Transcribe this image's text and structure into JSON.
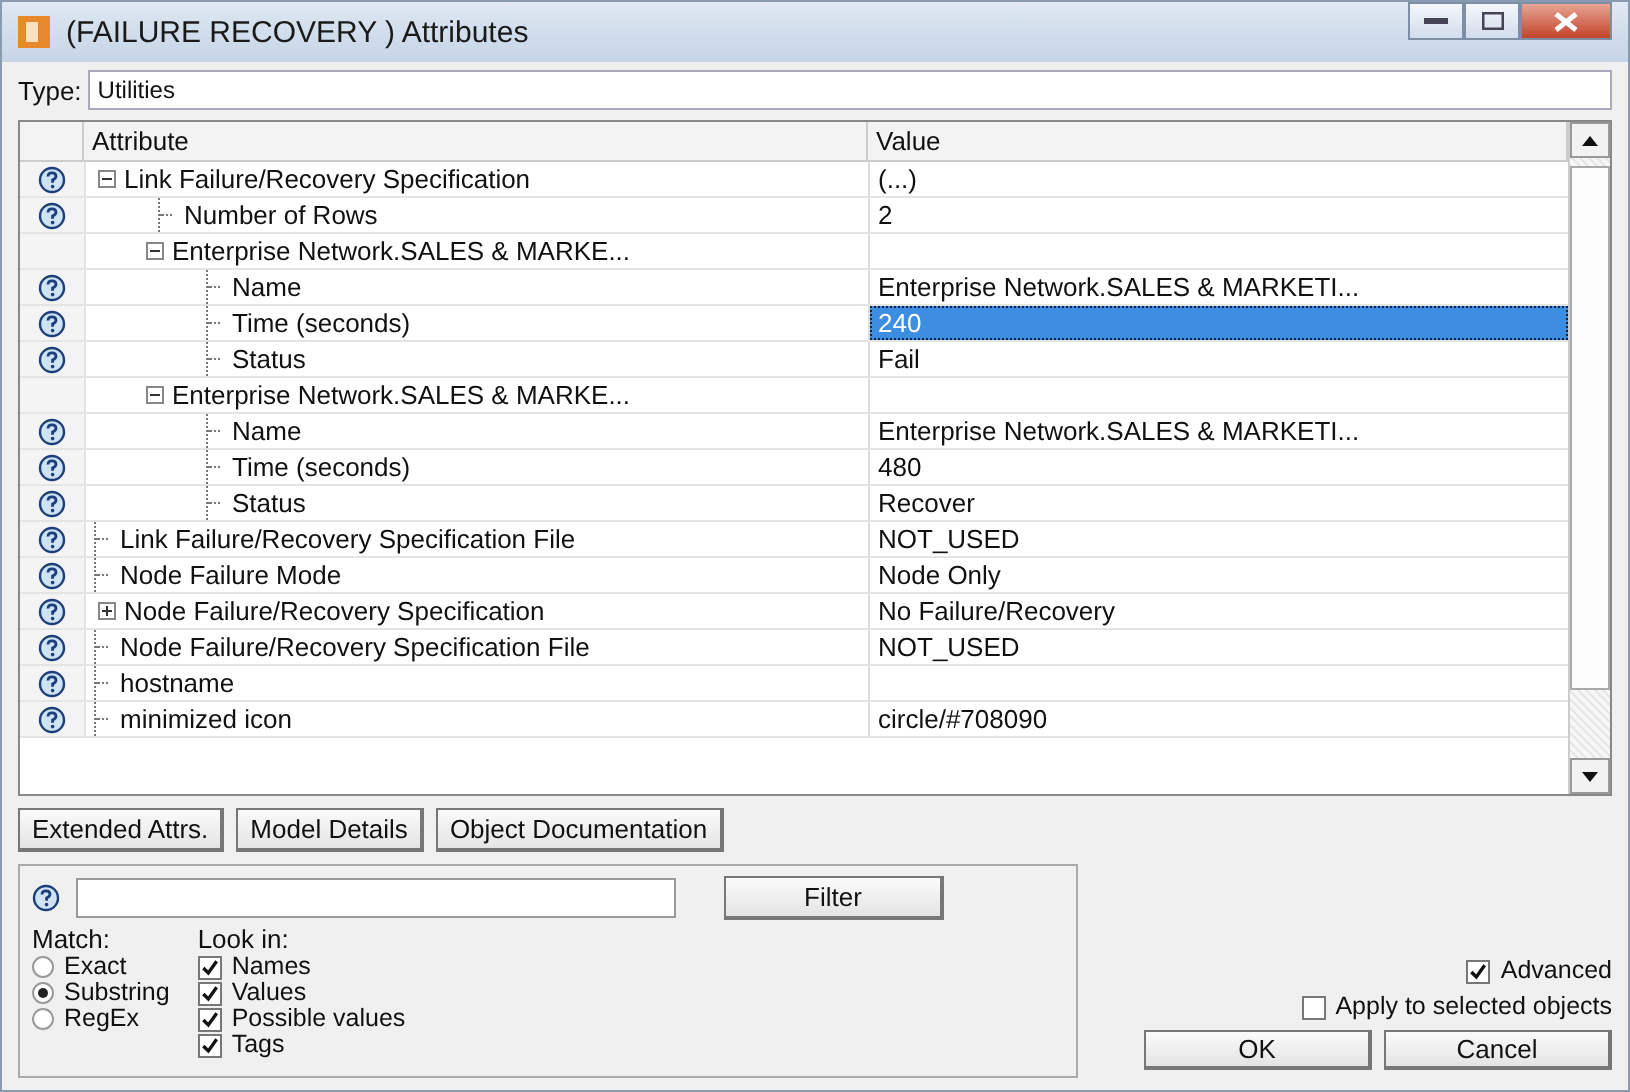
{
  "window": {
    "title": "(FAILURE RECOVERY ) Attributes"
  },
  "type_field": {
    "label": "Type:",
    "value": "Utilities"
  },
  "table": {
    "columns": [
      "Attribute",
      "Value"
    ],
    "rows": [
      {
        "kind": "group",
        "attribute": "Link Failure/Recovery Specification",
        "value": "(...)",
        "help": true,
        "expanded": true,
        "selected": false,
        "children": [
          {
            "kind": "leaf",
            "attribute": "Number of Rows",
            "value": "2",
            "help": true,
            "selected": false
          },
          {
            "kind": "group",
            "attribute": "Enterprise Network.SALES & MARKE...",
            "help": false,
            "expanded": true,
            "selected": false,
            "children": [
              {
                "kind": "leaf",
                "attribute": "Name",
                "value": "Enterprise Network.SALES & MARKETI...",
                "help": true,
                "selected": false
              },
              {
                "kind": "leaf",
                "attribute": "Time (seconds)",
                "value": "240",
                "help": true,
                "selected": true
              },
              {
                "kind": "leaf",
                "attribute": "Status",
                "value": "Fail",
                "help": true,
                "selected": false
              }
            ]
          },
          {
            "kind": "group",
            "attribute": "Enterprise Network.SALES & MARKE...",
            "help": false,
            "expanded": true,
            "selected": false,
            "children": [
              {
                "kind": "leaf",
                "attribute": "Name",
                "value": "Enterprise Network.SALES & MARKETI...",
                "help": true,
                "selected": false
              },
              {
                "kind": "leaf",
                "attribute": "Time (seconds)",
                "value": "480",
                "help": true,
                "selected": false
              },
              {
                "kind": "leaf",
                "attribute": "Status",
                "value": "Recover",
                "help": true,
                "selected": false
              }
            ]
          }
        ]
      },
      {
        "kind": "leaf",
        "attribute": "Link Failure/Recovery Specification File",
        "value": "NOT_USED",
        "help": true,
        "selected": false
      },
      {
        "kind": "leaf",
        "attribute": "Node Failure Mode",
        "value": "Node Only",
        "help": true,
        "selected": false
      },
      {
        "kind": "group",
        "attribute": "Node Failure/Recovery Specification",
        "value": "No Failure/Recovery",
        "help": true,
        "expanded": false,
        "selected": false
      },
      {
        "kind": "leaf",
        "attribute": "Node Failure/Recovery Specification File",
        "value": "NOT_USED",
        "help": true,
        "selected": false
      },
      {
        "kind": "leaf",
        "attribute": "hostname",
        "help": true,
        "selected": false
      },
      {
        "kind": "leaf",
        "attribute": "minimized icon",
        "value": "circle/#708090",
        "help": true,
        "selected": false
      }
    ]
  },
  "buttons": [
    "Extended Attrs.",
    "Model Details",
    "Object Documentation"
  ],
  "filter": {
    "button": "Filter",
    "match": {
      "label": "Match:",
      "options": [
        {
          "label": "Exact",
          "selected": false
        },
        {
          "label": "Substring",
          "selected": true
        },
        {
          "label": "RegEx",
          "selected": false
        }
      ]
    },
    "look_in": {
      "label": "Look in:",
      "options": [
        {
          "label": "Names",
          "checked": true
        },
        {
          "label": "Values",
          "checked": true
        },
        {
          "label": "Possible values",
          "checked": true
        },
        {
          "label": "Tags",
          "checked": true
        }
      ]
    }
  },
  "advanced": {
    "label": "Advanced",
    "checked": true
  },
  "apply_selected": {
    "label": "Apply to selected objects",
    "checked": false
  },
  "dialog_buttons": [
    "OK",
    "Cancel"
  ]
}
